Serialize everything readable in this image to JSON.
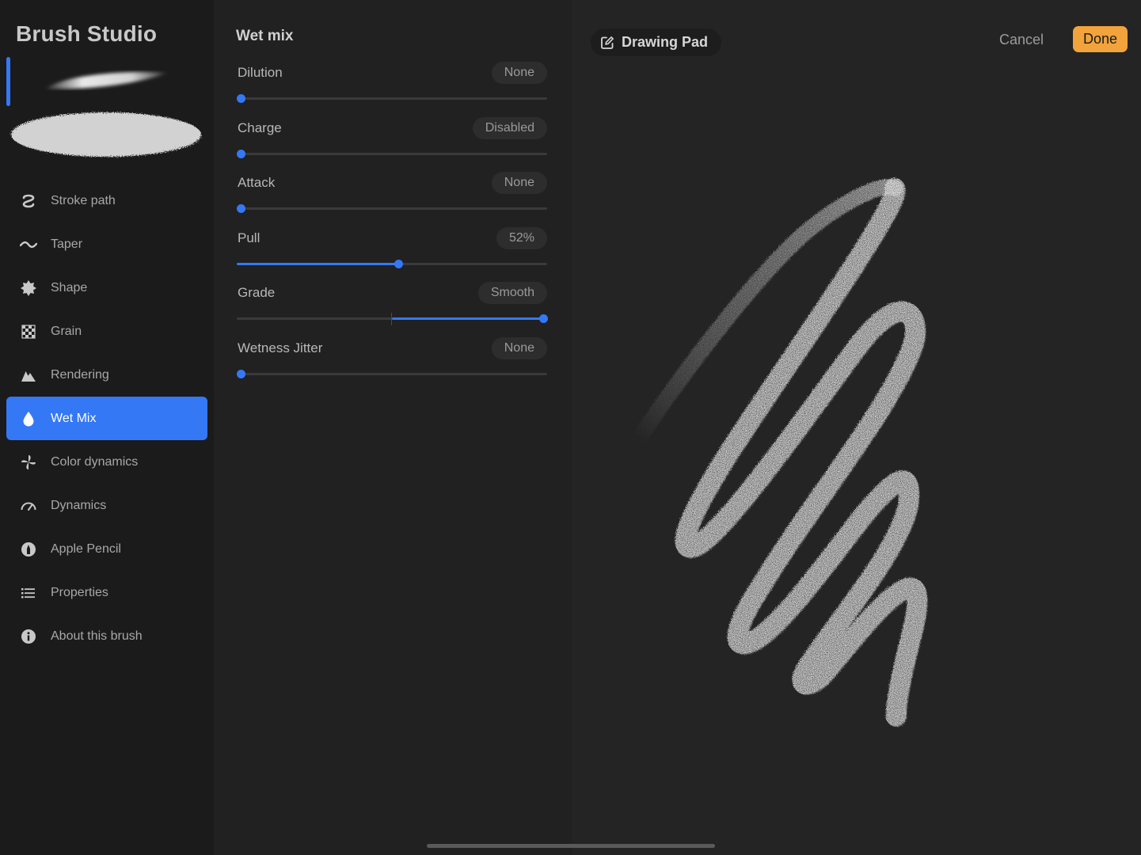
{
  "sidebar": {
    "title": "Brush Studio",
    "items": [
      {
        "label": "Stroke path",
        "icon": "stroke-path-icon"
      },
      {
        "label": "Taper",
        "icon": "taper-icon"
      },
      {
        "label": "Shape",
        "icon": "shape-icon"
      },
      {
        "label": "Grain",
        "icon": "grain-icon"
      },
      {
        "label": "Rendering",
        "icon": "rendering-icon"
      },
      {
        "label": "Wet Mix",
        "icon": "water-drop-icon",
        "active": true
      },
      {
        "label": "Color dynamics",
        "icon": "color-dynamics-icon"
      },
      {
        "label": "Dynamics",
        "icon": "speedometer-icon"
      },
      {
        "label": "Apple Pencil",
        "icon": "pencil-info-icon"
      },
      {
        "label": "Properties",
        "icon": "list-icon"
      },
      {
        "label": "About this brush",
        "icon": "info-icon"
      }
    ]
  },
  "settings": {
    "title": "Wet mix",
    "rows": [
      {
        "label": "Dilution",
        "value": "None",
        "level": 0
      },
      {
        "label": "Charge",
        "value": "Disabled",
        "level": 0
      },
      {
        "label": "Attack",
        "value": "None",
        "level": 0
      },
      {
        "label": "Pull",
        "value": "52%",
        "level": 0.52
      },
      {
        "label": "Grade",
        "value": "Smooth",
        "level": 1.0,
        "centered": true
      },
      {
        "label": "Wetness Jitter",
        "value": "None",
        "level": 0
      }
    ]
  },
  "drawing_pad": {
    "label": "Drawing Pad",
    "cancel_label": "Cancel",
    "done_label": "Done"
  },
  "colors": {
    "accent": "#3478f6",
    "done_button": "#f2a33b"
  }
}
